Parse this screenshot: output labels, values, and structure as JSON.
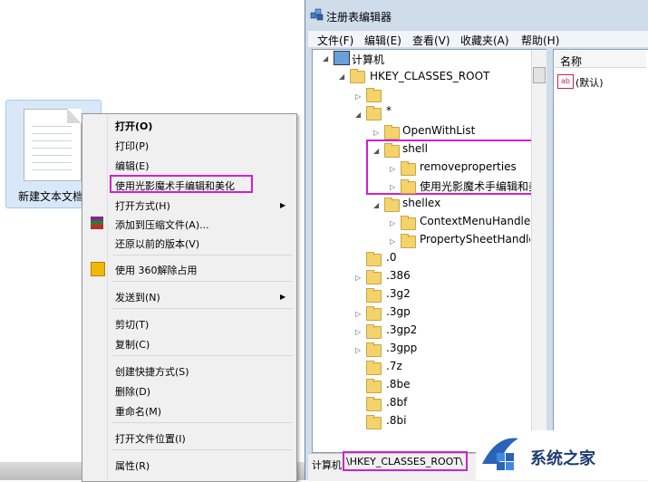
{
  "desktop": {
    "file_label": "新建文本文档"
  },
  "context_menu": {
    "items": [
      {
        "label": "打开(O)"
      },
      {
        "label": "打印(P)"
      },
      {
        "label": "编辑(E)"
      },
      {
        "label": "使用光影魔术手编辑和美化"
      },
      {
        "label": "打开方式(H)"
      },
      {
        "label": "添加到压缩文件(A)..."
      },
      {
        "label": "还原以前的版本(V)"
      },
      {
        "label": "使用 360解除占用"
      },
      {
        "label": "发送到(N)"
      },
      {
        "label": "剪切(T)"
      },
      {
        "label": "复制(C)"
      },
      {
        "label": "创建快捷方式(S)"
      },
      {
        "label": "删除(D)"
      },
      {
        "label": "重命名(M)"
      },
      {
        "label": "打开文件位置(I)"
      },
      {
        "label": "属性(R)"
      }
    ],
    "submenu_arrow": "▶"
  },
  "registry": {
    "title": "注册表编辑器",
    "menus": [
      "文件(F)",
      "编辑(E)",
      "查看(V)",
      "收藏夹(A)",
      "帮助(H)"
    ],
    "tree": {
      "computer": "计算机",
      "hkcr": "HKEY_CLASSES_ROOT",
      "star": "*",
      "openwithlist": "OpenWithList",
      "shell": "shell",
      "removeproperties": "removeproperties",
      "meitu": "使用光影魔术手编辑和美",
      "shellex": "shellex",
      "contextmenuhandlers": "ContextMenuHandlers",
      "propertysheethandlers": "PropertySheetHandlers",
      "ext": [
        ".0",
        ".386",
        ".3g2",
        ".3gp",
        ".3gp2",
        ".3gpp",
        ".7z",
        ".8be",
        ".8bf",
        ".8bi"
      ]
    },
    "right_pane": {
      "column_name": "名称",
      "value_icon": "ab",
      "value_name": "(默认)"
    },
    "status": {
      "prefix": "计算机",
      "key": "\\HKEY_CLASSES_ROOT\\"
    }
  },
  "watermark": {
    "text": "系统之家"
  },
  "colors": {
    "highlight_border": "#d020d0",
    "folder": "#f4d36b"
  }
}
